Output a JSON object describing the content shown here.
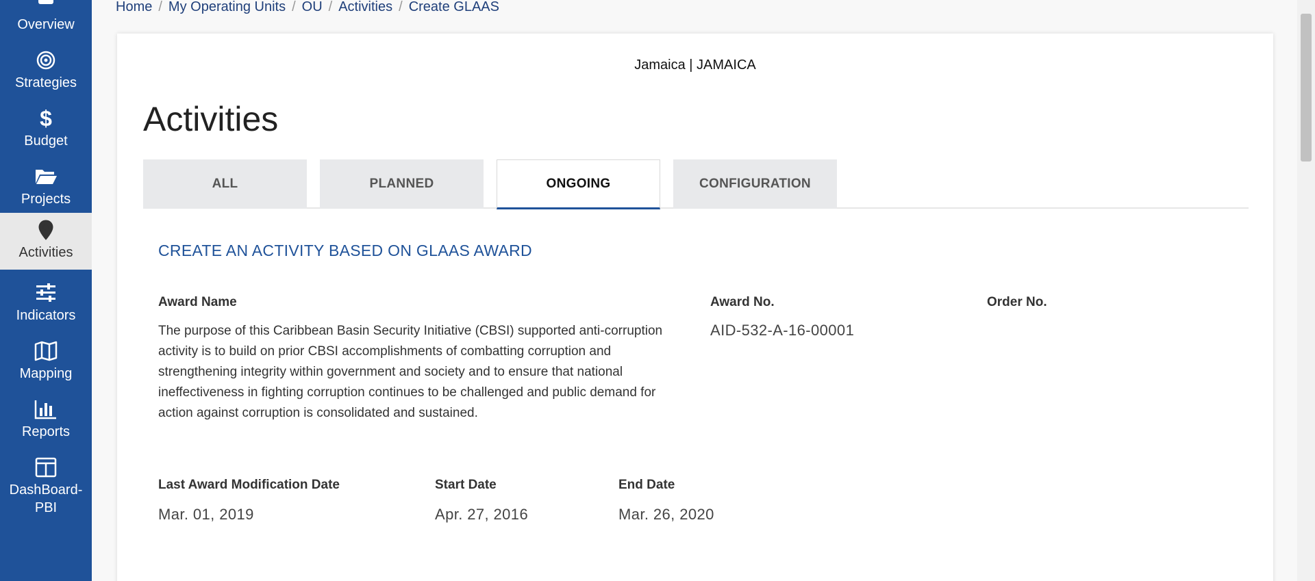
{
  "sidebar": {
    "items": [
      {
        "label": "Overview",
        "icon": "overview-icon"
      },
      {
        "label": "Strategies",
        "icon": "target-icon"
      },
      {
        "label": "Budget",
        "icon": "dollar-icon"
      },
      {
        "label": "Projects",
        "icon": "folder-icon"
      },
      {
        "label": "Activities",
        "icon": "map-pin-icon",
        "active": true
      },
      {
        "label": "Indicators",
        "icon": "sliders-icon"
      },
      {
        "label": "Mapping",
        "icon": "map-icon"
      },
      {
        "label": "Reports",
        "icon": "bar-chart-icon"
      },
      {
        "label": "DashBoard-PBI",
        "icon": "dashboard-icon"
      }
    ]
  },
  "breadcrumb": {
    "items": [
      "Home",
      "My Operating Units",
      "OU",
      "Activities",
      "Create GLAAS"
    ]
  },
  "header": {
    "ou_name": "Jamaica | JAMAICA",
    "title": "Activities"
  },
  "tabs": [
    {
      "label": "ALL"
    },
    {
      "label": "PLANNED"
    },
    {
      "label": "ONGOING",
      "active": true
    },
    {
      "label": "CONFIGURATION"
    }
  ],
  "section": {
    "title": "CREATE AN ACTIVITY BASED ON GLAAS AWARD"
  },
  "award": {
    "name_label": "Award Name",
    "name_value": "The purpose of this Caribbean Basin Security Initiative (CBSI) supported anti-corruption activity is to build on prior CBSI accomplishments of combatting corruption and strengthening integrity within government and society and to ensure that national ineffectiveness in fighting corruption continues to be challenged and public demand for action against corruption is consolidated and sustained.",
    "number_label": "Award No.",
    "number_value": "AID-532-A-16-00001",
    "order_label": "Order No.",
    "order_value": "",
    "last_mod_label": "Last Award Modification Date",
    "last_mod_value": "Mar. 01, 2019",
    "start_label": "Start Date",
    "start_value": "Apr. 27, 2016",
    "end_label": "End Date",
    "end_value": "Mar. 26, 2020"
  },
  "colors": {
    "sidebar_bg": "#1f5299",
    "accent": "#1f5299",
    "active_nav_bg": "#e8e8e8"
  }
}
